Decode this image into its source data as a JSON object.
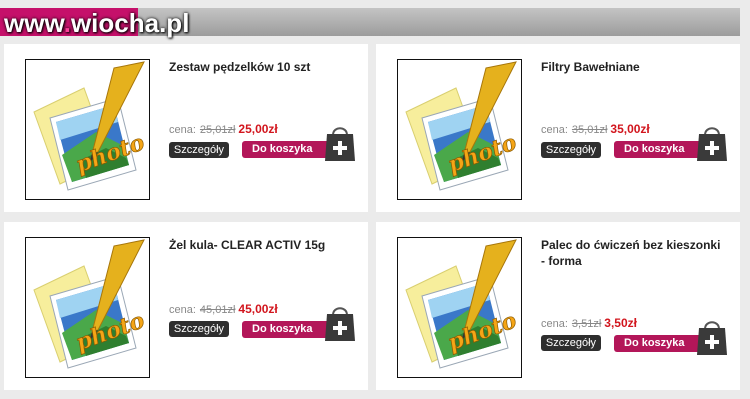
{
  "watermark": {
    "text_a": "www",
    "dot": ".",
    "text_b": "wiocha.pl"
  },
  "products": [
    {
      "title": "Zestaw pędzelków 10 szt",
      "price_label": "cena:",
      "old_price": "25,01zł",
      "new_price": "25,00zł",
      "details_label": "Szczegóły",
      "cart_label": "Do koszyka",
      "image_text": "photo"
    },
    {
      "title": "Filtry Bawełniane",
      "price_label": "cena:",
      "old_price": "35,01zł",
      "new_price": "35,00zł",
      "details_label": "Szczegóły",
      "cart_label": "Do koszyka",
      "image_text": "photo"
    },
    {
      "title": "Żel kula- CLEAR ACTIV 15g",
      "price_label": "cena:",
      "old_price": "45,01zł",
      "new_price": "45,00zł",
      "details_label": "Szczegóły",
      "cart_label": "Do koszyka",
      "image_text": "photo"
    },
    {
      "title": "Palec do ćwiczeń bez kieszonki - forma",
      "price_label": "cena:",
      "old_price": "3,51zł",
      "new_price": "3,50zł",
      "details_label": "Szczegóły",
      "cart_label": "Do koszyka",
      "image_text": "photo"
    }
  ],
  "colors": {
    "accent": "#c5106a",
    "price": "#d2151d",
    "cart_button": "#b31659",
    "details_button": "#2e2e2e"
  },
  "icons": {
    "bag": "shopping-bag-plus-icon",
    "thumbnail": "photo-placeholder-icon"
  }
}
